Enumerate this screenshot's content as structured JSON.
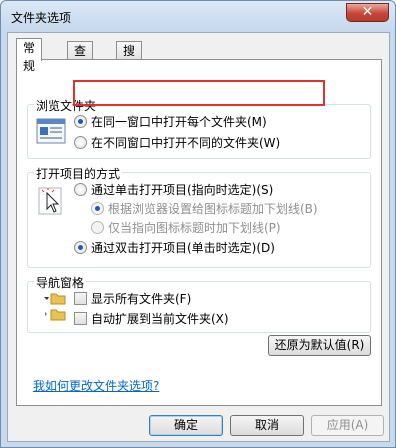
{
  "window": {
    "title": "文件夹选项",
    "close_glyph": "✕"
  },
  "tabs": [
    {
      "label": "常规",
      "active": true
    },
    {
      "label": "查看",
      "active": false
    },
    {
      "label": "搜索",
      "active": false
    }
  ],
  "browse_group": {
    "label": "浏览文件夹",
    "options": [
      {
        "label": "在同一窗口中打开每个文件夹(M)",
        "selected": true
      },
      {
        "label": "在不同窗口中打开不同的文件夹(W)",
        "selected": false
      }
    ]
  },
  "click_group": {
    "label": "打开项目的方式",
    "options": [
      {
        "label": "通过单击打开项目(指向时选定)(S)",
        "selected": false,
        "enabled": true
      },
      {
        "label": "根据浏览器设置给图标标题加下划线(B)",
        "selected": true,
        "enabled": false
      },
      {
        "label": "仅当指向图标标题时加下划线(P)",
        "selected": false,
        "enabled": false
      },
      {
        "label": "通过双击打开项目(单击时选定)(D)",
        "selected": true,
        "enabled": true
      }
    ]
  },
  "nav_group": {
    "label": "导航窗格",
    "options": [
      {
        "label": "显示所有文件夹(F)",
        "checked": false
      },
      {
        "label": "自动扩展到当前文件夹(X)",
        "checked": false
      }
    ]
  },
  "restore_defaults_label": "还原为默认值(R)",
  "help_link": "我如何更改文件夹选项?",
  "footer": {
    "ok": "确定",
    "cancel": "取消",
    "apply": "应用(A)"
  },
  "colors": {
    "selection_highlight": "#e03030",
    "link": "#0066cc",
    "window_frame": "#c9d9ec"
  }
}
